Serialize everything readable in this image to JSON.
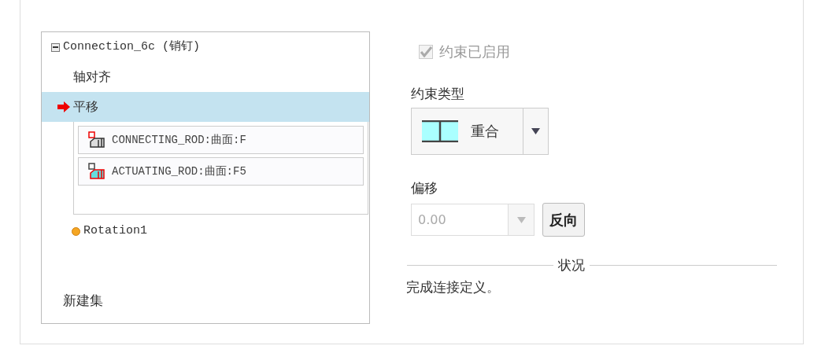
{
  "tree": [
    {
      "kind": "connection",
      "label": "Connection_6c (销钉)",
      "expanded": true,
      "children": [
        {
          "label": "轴对齐",
          "selected": false
        },
        {
          "label": "平移",
          "selected": true,
          "references": [
            "CONNECTING_ROD:曲面:F",
            "ACTUATING_ROD:曲面:F5"
          ]
        }
      ]
    },
    {
      "kind": "motion",
      "label": "Rotation1"
    }
  ],
  "new_set": "新建集",
  "enabled": {
    "label": "约束已启用",
    "checked": true,
    "disabled": true
  },
  "constraint_type": {
    "label": "约束类型",
    "value": "重合"
  },
  "offset": {
    "label": "偏移",
    "value": "0.00",
    "disabled": true,
    "button": "反向"
  },
  "status": {
    "title": "状况",
    "message": "完成连接定义。"
  }
}
